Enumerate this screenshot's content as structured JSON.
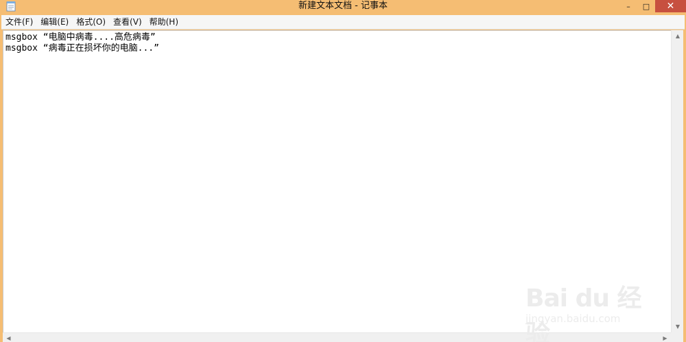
{
  "window": {
    "title": "新建文本文档 - 记事本",
    "app_icon": "notepad-icon",
    "controls": {
      "minimize": "–",
      "maximize": "□",
      "close": "✕"
    },
    "colors": {
      "frame": "#f5bd73",
      "close_button": "#c7503f"
    }
  },
  "menu": {
    "items": [
      {
        "label": "文件(F)"
      },
      {
        "label": "编辑(E)"
      },
      {
        "label": "格式(O)"
      },
      {
        "label": "查看(V)"
      },
      {
        "label": "帮助(H)"
      }
    ]
  },
  "editor": {
    "lines": [
      "msgbox “电脑中病毒....高危病毒”",
      "msgbox “病毒正在损坏你的电脑...”"
    ]
  },
  "scrollbars": {
    "up_arrow": "▲",
    "down_arrow": "▼",
    "left_arrow": "◀",
    "right_arrow": "▶"
  },
  "watermark": {
    "logo": "Bai du 经验",
    "url": "jingyan.baidu.com"
  }
}
